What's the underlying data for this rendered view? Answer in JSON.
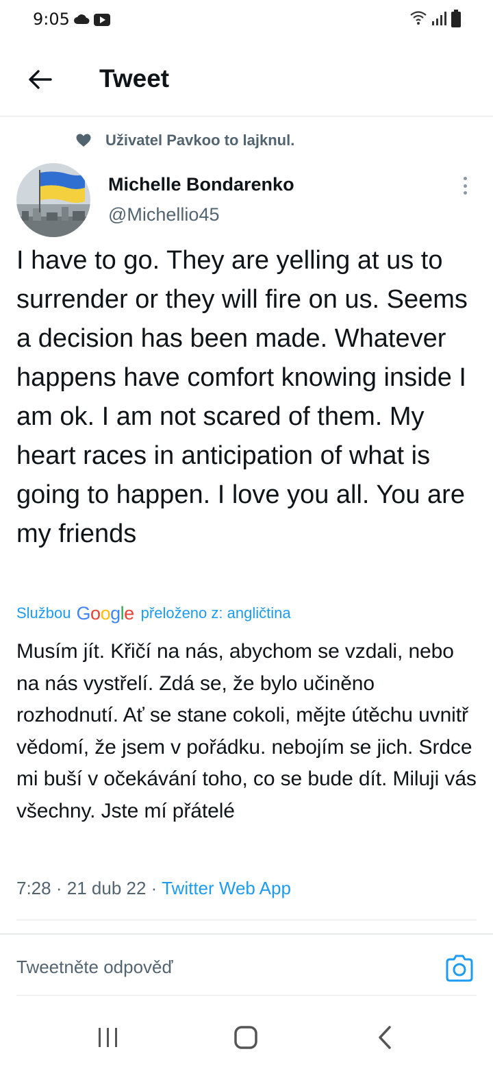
{
  "status_bar": {
    "time": "9:05",
    "icons": [
      "cloud-icon",
      "youtube-icon",
      "wifi-icon",
      "signal-icon",
      "battery-icon"
    ]
  },
  "header": {
    "title": "Tweet",
    "back_icon": "arrow-left-icon"
  },
  "social_context": {
    "icon": "heart-icon",
    "text": "Uživatel Pavkoo to lajknul."
  },
  "author": {
    "name": "Michelle Bondarenko",
    "handle": "@Michellio45"
  },
  "tweet": {
    "text": "I have to go. They are yelling at us to surrender or they will fire on us. Seems a decision has been made. Whatever happens have comfort knowing inside I am ok.  I am not scared of them. My heart races in anticipation of what is going to happen. I love you all. You are my friends",
    "translation_prefix": "Službou",
    "translation_brand": "Google",
    "translation_suffix": "přeloženo z: angličtina",
    "translated_text": "Musím jít. Křičí na nás, abychom se vzdali, nebo na nás vystřelí. Zdá se, že bylo učiněno rozhodnutí. Ať se stane cokoli, mějte útěchu uvnitř vědomí, že jsem v pořádku. nebojím se jich. Srdce mi buší v očekávání toho, co se bude dít. Miluji vás všechny. Jste mí přátelé",
    "time": "7:28",
    "date": "21 dub 22",
    "source": "Twitter Web App",
    "separator": "·"
  },
  "reply": {
    "placeholder": "Tweetněte odpověď",
    "camera_icon": "camera-icon"
  },
  "colors": {
    "accent": "#1d9bf0",
    "secondary_text": "#536471",
    "divider": "#e6e9eb",
    "text": "#0f1419"
  }
}
